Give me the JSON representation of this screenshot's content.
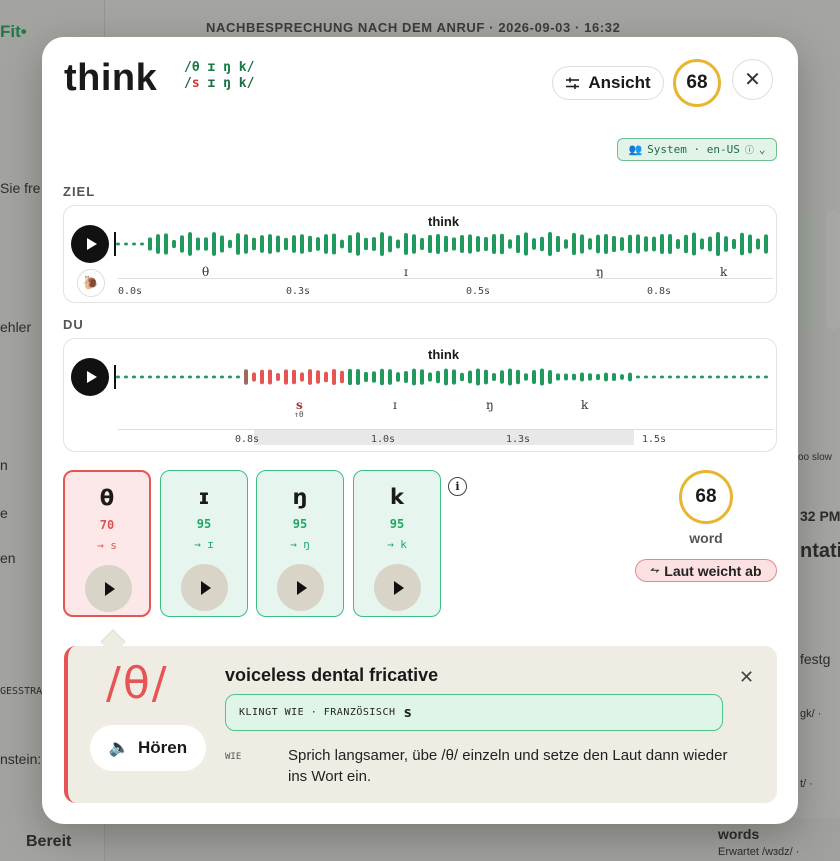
{
  "background": {
    "header": "NACHBESPRECHUNG NACH DEM ANRUF · 2026-09-03 · 16:32",
    "left_texts": [
      "Fit•",
      "Sie fre",
      "ehler",
      "n",
      "e",
      "en",
      "GESSTRA",
      "nstein:",
      "Bereit"
    ],
    "right_texts": [
      "oo slow",
      "32 PM",
      "ntati",
      "festg",
      "gk/ ·",
      "t/ ·",
      "words",
      "Erwartet /wɜdz/ ·"
    ]
  },
  "modal": {
    "word": "think",
    "ipa_target": "/θ ɪ ŋ k/",
    "ipa_user_prefix": "/",
    "ipa_user_error": "s",
    "ipa_user_rest": " ɪ ŋ k/",
    "view_button": "Ansicht",
    "score": "68",
    "system_pill": "System · en-US",
    "target_section": {
      "label": "ZIEL",
      "title": "think",
      "phonemes": [
        "θ",
        "ɪ",
        "ŋ",
        "k"
      ],
      "ticks": [
        "0.0s",
        "0.3s",
        "0.5s",
        "0.8s"
      ]
    },
    "user_section": {
      "label": "DU",
      "title": "think",
      "phonemes": [
        "s",
        "ɪ",
        "ŋ",
        "k"
      ],
      "error_hint": "↑θ",
      "ticks": [
        "0.8s",
        "1.0s",
        "1.3s",
        "1.5s"
      ]
    },
    "phoneme_cards": [
      {
        "symbol": "θ",
        "score": "70",
        "heard": "→ s",
        "status": "bad"
      },
      {
        "symbol": "ɪ",
        "score": "95",
        "heard": "→ ɪ",
        "status": "good"
      },
      {
        "symbol": "ŋ",
        "score": "95",
        "heard": "→ ŋ",
        "status": "good"
      },
      {
        "symbol": "k",
        "score": "95",
        "heard": "→ k",
        "status": "good"
      }
    ],
    "word_score": "68",
    "word_score_label": "word",
    "deviation_pill": "Laut weicht ab",
    "detail": {
      "phoneme": "/θ/",
      "hear_button": "Hören",
      "title": "voiceless dental fricative",
      "sounds_like_label": "KLINGT WIE · FRANZÖSISCH",
      "sounds_like_value": "s",
      "how_label": "WIE",
      "how_text": "Sprich langsamer, übe /θ/ einzeln und setze den Laut dann wieder ins Wort ein."
    }
  },
  "colors": {
    "good": "#1f9a5c",
    "bad": "#e65454",
    "score_ring": "#e8b530"
  }
}
